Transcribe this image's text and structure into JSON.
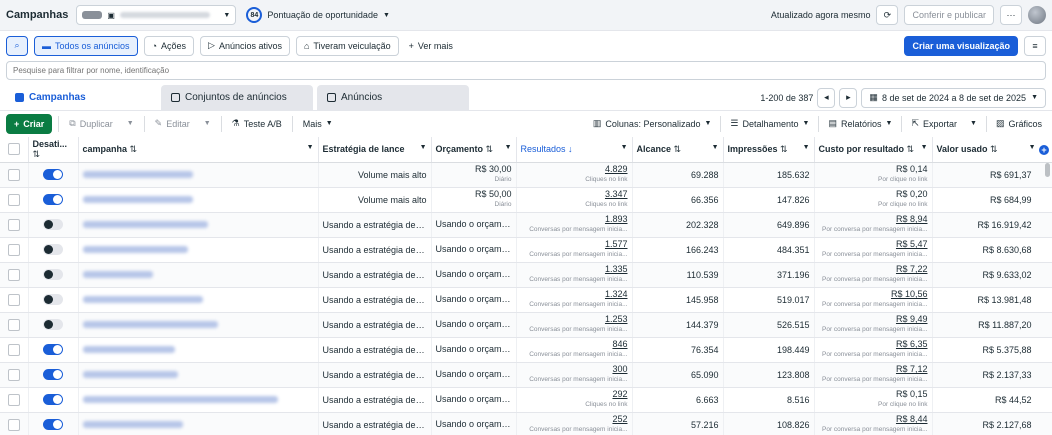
{
  "header": {
    "title": "Campanhas",
    "score_value": "84",
    "score_label": "Pontuação de oportunidade",
    "updated": "Atualizado agora mesmo",
    "review_publish": "Conferir e publicar",
    "more": "···"
  },
  "filters": {
    "all_ads": "Todos os anúncios",
    "actions": "Ações",
    "active_ads": "Anúncios ativos",
    "had_delivery": "Tiveram veiculação",
    "see_more": "Ver mais",
    "create_view": "Criar uma visualização"
  },
  "search": {
    "placeholder": "Pesquise para filtrar por nome, identificação"
  },
  "tabs": [
    {
      "label": "Campanhas"
    },
    {
      "label": "Conjuntos de anúncios"
    },
    {
      "label": "Anúncios"
    }
  ],
  "pagination": {
    "range": "1-200 de 387"
  },
  "date_range": "8 de set de 2024 a 8 de set de 2025",
  "toolbar": {
    "create": "Criar",
    "duplicate": "Duplicar",
    "edit": "Editar",
    "ab_test": "Teste A/B",
    "more": "Mais",
    "columns": "Colunas: Personalizado",
    "breakdown": "Detalhamento",
    "reports": "Relatórios",
    "export": "Exportar",
    "charts": "Gráficos"
  },
  "columns": {
    "toggle": "Desati...",
    "campaign": "campanha",
    "bid": "Estratégia de lance",
    "budget": "Orçamento",
    "results": "Resultados",
    "reach": "Alcance",
    "impressions": "Impressões",
    "cpr": "Custo por resultado",
    "spent": "Valor usado"
  },
  "rows": [
    {
      "on": true,
      "name_w": 110,
      "bid": "Volume mais alto",
      "budget": "R$ 30,00",
      "budget_sub": "Diário",
      "results": "4.829",
      "results_sub": "Cliques no link",
      "reach": "69.288",
      "impr": "185.632",
      "cpr": "R$ 0,14",
      "cpr_sub": "Por clique no link",
      "spent": "R$ 691,37"
    },
    {
      "on": true,
      "name_w": 110,
      "bid": "Volume mais alto",
      "budget": "R$ 50,00",
      "budget_sub": "Diário",
      "results": "3.347",
      "results_sub": "Cliques no link",
      "reach": "66.356",
      "impr": "147.826",
      "cpr": "R$ 0,20",
      "cpr_sub": "Por clique no link",
      "spent": "R$ 684,99"
    },
    {
      "on": false,
      "name_w": 125,
      "bid": "Usando a estratégia de lanc...",
      "budget": "Usando o orçament...",
      "budget_sub": "",
      "results": "1.893",
      "results_sub": "Conversas por mensagem inicia...",
      "reach": "202.328",
      "impr": "649.896",
      "cpr": "R$ 8,94",
      "cpr_sub": "Por conversa por mensagem inicia...",
      "spent": "R$ 16.919,42"
    },
    {
      "on": false,
      "name_w": 105,
      "bid": "Usando a estratégia de lanc...",
      "budget": "Usando o orçament...",
      "budget_sub": "",
      "results": "1.577",
      "results_sub": "Conversas por mensagem inicia...",
      "reach": "166.243",
      "impr": "484.351",
      "cpr": "R$ 5,47",
      "cpr_sub": "Por conversa por mensagem inicia...",
      "spent": "R$ 8.630,68"
    },
    {
      "on": false,
      "name_w": 70,
      "bid": "Usando a estratégia de lanc...",
      "budget": "Usando o orçament...",
      "budget_sub": "",
      "results": "1.335",
      "results_sub": "Conversas por mensagem inicia...",
      "reach": "110.539",
      "impr": "371.196",
      "cpr": "R$ 7,22",
      "cpr_sub": "Por conversa por mensagem inicia...",
      "spent": "R$ 9.633,02"
    },
    {
      "on": false,
      "name_w": 120,
      "bid": "Usando a estratégia de lanc...",
      "budget": "Usando o orçament...",
      "budget_sub": "",
      "results": "1.324",
      "results_sub": "Conversas por mensagem inicia...",
      "reach": "145.958",
      "impr": "519.017",
      "cpr": "R$ 10,56",
      "cpr_sub": "Por conversa por mensagem inicia...",
      "spent": "R$ 13.981,48"
    },
    {
      "on": false,
      "name_w": 135,
      "bid": "Usando a estratégia de lanc...",
      "budget": "Usando o orçament...",
      "budget_sub": "",
      "results": "1.253",
      "results_sub": "Conversas por mensagem inicia...",
      "reach": "144.379",
      "impr": "526.515",
      "cpr": "R$ 9,49",
      "cpr_sub": "Por conversa por mensagem inicia...",
      "spent": "R$ 11.887,20"
    },
    {
      "on": true,
      "name_w": 92,
      "bid": "Usando a estratégia de lanc...",
      "budget": "Usando o orçament...",
      "budget_sub": "",
      "results": "846",
      "results_sub": "Conversas por mensagem inicia...",
      "reach": "76.354",
      "impr": "198.449",
      "cpr": "R$ 6,35",
      "cpr_sub": "Por conversa por mensagem inicia...",
      "spent": "R$ 5.375,88"
    },
    {
      "on": true,
      "name_w": 95,
      "bid": "Usando a estratégia de lanc...",
      "budget": "Usando o orçament...",
      "budget_sub": "",
      "results": "300",
      "results_sub": "Conversas por mensagem inicia...",
      "reach": "65.090",
      "impr": "123.808",
      "cpr": "R$ 7,12",
      "cpr_sub": "Por conversa por mensagem inicia...",
      "spent": "R$ 2.137,33"
    },
    {
      "on": true,
      "name_w": 195,
      "bid": "Usando a estratégia de lanc...",
      "budget": "Usando o orçament...",
      "budget_sub": "",
      "results": "292",
      "results_sub": "Cliques no link",
      "reach": "6.663",
      "impr": "8.516",
      "cpr": "R$ 0,15",
      "cpr_sub": "Por clique no link",
      "spent": "R$ 44,52"
    },
    {
      "on": true,
      "name_w": 100,
      "bid": "Usando a estratégia de lanc...",
      "budget": "Usando o orçament...",
      "budget_sub": "",
      "results": "252",
      "results_sub": "Conversas por mensagem inicia...",
      "reach": "57.216",
      "impr": "108.826",
      "cpr": "R$ 8,44",
      "cpr_sub": "Por conversa por mensagem inicia...",
      "spent": "R$ 2.127,68"
    }
  ],
  "colors": {
    "accent": "#1a5ed8",
    "create": "#0a7c43"
  }
}
